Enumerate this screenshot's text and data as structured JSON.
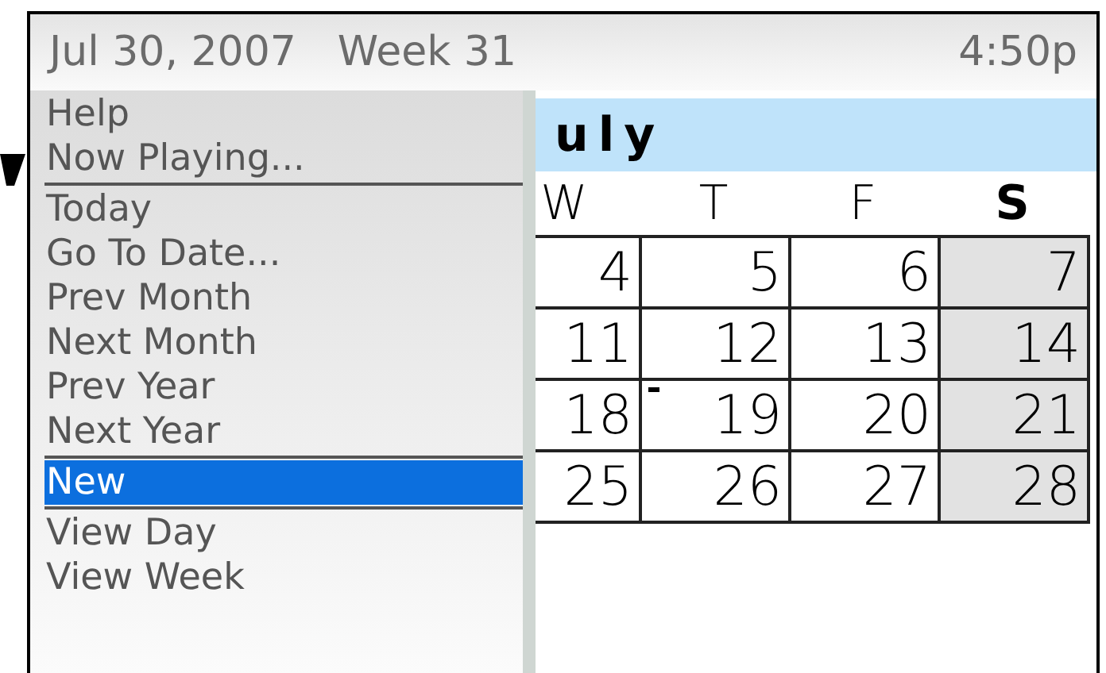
{
  "status_bar": {
    "date": "Jul 30, 2007",
    "week": "Week 31",
    "time": "4:50p"
  },
  "month": "uly",
  "weekdays": [
    {
      "label": "W",
      "bold": false
    },
    {
      "label": "T",
      "bold": false
    },
    {
      "label": "F",
      "bold": false
    },
    {
      "label": "S",
      "bold": true
    }
  ],
  "weeks": [
    [
      {
        "day": "4",
        "weekend": false,
        "marked": false
      },
      {
        "day": "5",
        "weekend": false,
        "marked": false
      },
      {
        "day": "6",
        "weekend": false,
        "marked": false
      },
      {
        "day": "7",
        "weekend": true,
        "marked": false
      }
    ],
    [
      {
        "day": "11",
        "weekend": false,
        "marked": false
      },
      {
        "day": "12",
        "weekend": false,
        "marked": false
      },
      {
        "day": "13",
        "weekend": false,
        "marked": false
      },
      {
        "day": "14",
        "weekend": true,
        "marked": false
      }
    ],
    [
      {
        "day": "18",
        "weekend": false,
        "marked": false
      },
      {
        "day": "19",
        "weekend": false,
        "marked": true
      },
      {
        "day": "20",
        "weekend": false,
        "marked": false
      },
      {
        "day": "21",
        "weekend": true,
        "marked": false
      }
    ],
    [
      {
        "day": "25",
        "weekend": false,
        "marked": false
      },
      {
        "day": "26",
        "weekend": false,
        "marked": false
      },
      {
        "day": "27",
        "weekend": false,
        "marked": false
      },
      {
        "day": "28",
        "weekend": true,
        "marked": false
      }
    ]
  ],
  "menu": {
    "items": [
      {
        "kind": "item",
        "label": "Help",
        "selected": false
      },
      {
        "kind": "item",
        "label": "Now Playing...",
        "selected": false
      },
      {
        "kind": "separator"
      },
      {
        "kind": "item",
        "label": "Today",
        "selected": false
      },
      {
        "kind": "item",
        "label": "Go To Date...",
        "selected": false
      },
      {
        "kind": "item",
        "label": "Prev Month",
        "selected": false
      },
      {
        "kind": "item",
        "label": "Next Month",
        "selected": false
      },
      {
        "kind": "item",
        "label": "Prev Year",
        "selected": false
      },
      {
        "kind": "item",
        "label": "Next Year",
        "selected": false
      },
      {
        "kind": "separator"
      },
      {
        "kind": "item",
        "label": "New",
        "selected": true
      },
      {
        "kind": "separator"
      },
      {
        "kind": "item",
        "label": "View Day",
        "selected": false
      },
      {
        "kind": "item",
        "label": "View Week",
        "selected": false
      }
    ]
  }
}
